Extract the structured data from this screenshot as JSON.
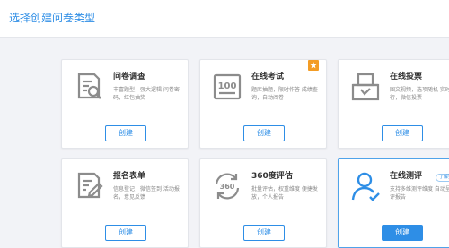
{
  "header": {
    "title": "选择创建问卷类型"
  },
  "cards": [
    {
      "title": "问卷调查",
      "desc": "丰富题型，强大逻辑 问卷密码，红包抽奖",
      "button": "创建",
      "icon": "survey-doc-search-icon"
    },
    {
      "title": "在线考试",
      "desc": "题库抽题，限时作答 成绩查询，自动阅卷",
      "button": "创建",
      "icon": "exam-score-100-icon",
      "badge": "star-icon"
    },
    {
      "title": "在线投票",
      "desc": "图文视频，选项随机 实时排行，微信投票",
      "button": "创建",
      "icon": "ballot-box-icon"
    },
    {
      "title": "报名表单",
      "desc": "信息登记，微信签到 活动报名，意见反馈",
      "button": "创建",
      "icon": "form-pen-icon"
    },
    {
      "title": "360度评估",
      "desc": "批量评估，权重维度 便捷发放，个人报告",
      "button": "创建",
      "icon": "evaluation-360-icon"
    },
    {
      "title": "在线测评",
      "desc": "支持多维测评维度 自动呈现测评报告",
      "button": "创建",
      "icon": "person-assessment-icon",
      "tag": "了解更多"
    }
  ],
  "colors": {
    "accent": "#2e8ee6",
    "badge": "#f39c25",
    "icon": "#8c8c8c",
    "icon_active": "#2e8ee6"
  }
}
